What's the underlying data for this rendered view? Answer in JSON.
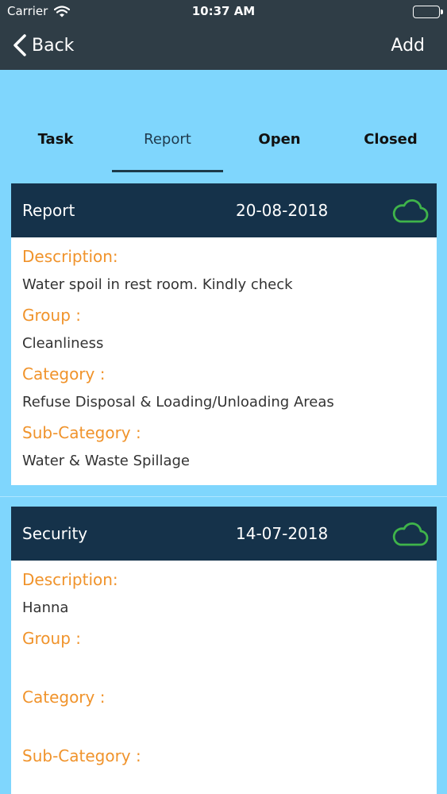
{
  "status": {
    "carrier": "Carrier",
    "time": "10:37 AM"
  },
  "nav": {
    "back_label": "Back",
    "add_label": "Add"
  },
  "tabs": [
    {
      "label": "Task"
    },
    {
      "label": "Report",
      "selected": true
    },
    {
      "label": "Open"
    },
    {
      "label": "Closed"
    }
  ],
  "cards": [
    {
      "type": "Report",
      "date": "20-08-2018",
      "description_label": "Description:",
      "description": "Water spoil in rest room. Kindly check",
      "group_label": "Group :",
      "group": "Cleanliness",
      "category_label": "Category :",
      "category": "Refuse Disposal & Loading/Unloading Areas",
      "subcategory_label": "Sub-Category :",
      "subcategory": "Water & Waste Spillage"
    },
    {
      "type": "Security",
      "date": "14-07-2018",
      "description_label": "Description:",
      "description": "Hanna",
      "group_label": "Group :",
      "group": "",
      "category_label": "Category :",
      "category": "",
      "subcategory_label": "Sub-Category :",
      "subcategory": ""
    }
  ],
  "colors": {
    "navbar": "#2f3d46",
    "background": "#7fd6fd",
    "card_header": "#15324a",
    "label": "#f0932b",
    "cloud_icon": "#3fb44a"
  },
  "icons": {
    "back": "chevron-left-icon",
    "sync": "cloud-icon"
  }
}
